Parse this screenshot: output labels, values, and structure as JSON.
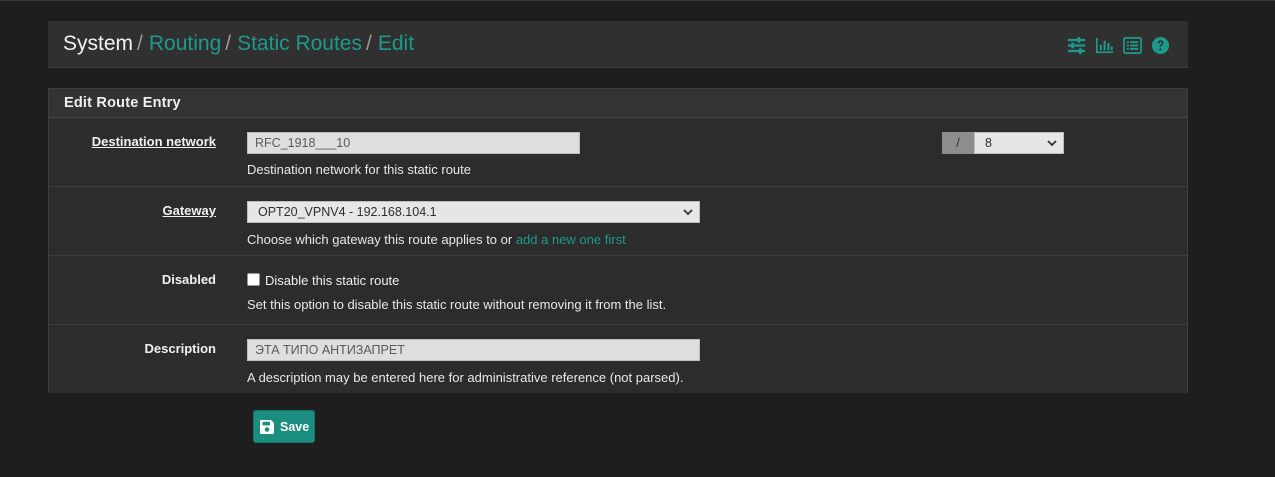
{
  "breadcrumb": {
    "root": "System",
    "separator": "/",
    "items": [
      "Routing",
      "Static Routes",
      "Edit"
    ]
  },
  "header_icons": [
    "sliders-icon",
    "bar-chart-icon",
    "list-icon",
    "help-icon"
  ],
  "panel": {
    "title": "Edit Route Entry"
  },
  "fields": {
    "destination": {
      "label": "Destination network",
      "value": "RFC_1918___10",
      "mask_separator": "/",
      "mask_value": "8",
      "help": "Destination network for this static route"
    },
    "gateway": {
      "label": "Gateway",
      "value": "OPT20_VPNV4 - 192.168.104.1",
      "help_prefix": "Choose which gateway this route applies to or ",
      "help_link": "add a new one first"
    },
    "disabled": {
      "label": "Disabled",
      "checkbox_label": "Disable this static route",
      "checked": false,
      "help": "Set this option to disable this static route without removing it from the list."
    },
    "description": {
      "label": "Description",
      "value": "ЭТА ТИПО АНТИЗАПРЕТ",
      "help": "A description may be entered here for administrative reference (not parsed)."
    }
  },
  "save_button": {
    "label": "Save",
    "icon": "save-icon"
  },
  "colors": {
    "accent": "#1d9a8c",
    "button": "#1b8e7f",
    "background": "#1e1e1e",
    "panel": "#2c2c2c"
  }
}
